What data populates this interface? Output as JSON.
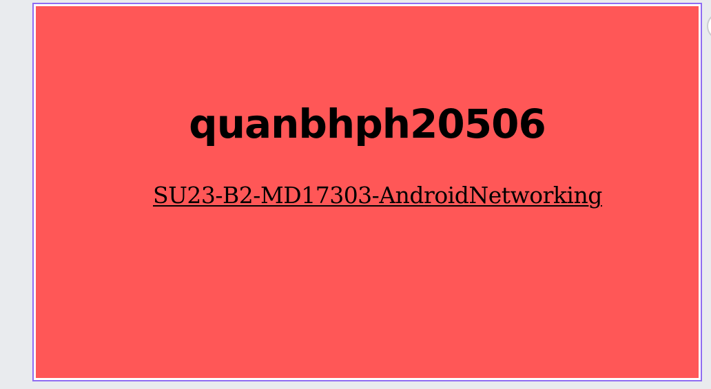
{
  "card": {
    "title": "quanbhph20506",
    "link_text": "SU23-B2-MD17303-AndroidNetworking",
    "background_color": "#ff5757",
    "frame_color": "#8f6cf2"
  },
  "page": {
    "background_color": "#e9ebee"
  }
}
